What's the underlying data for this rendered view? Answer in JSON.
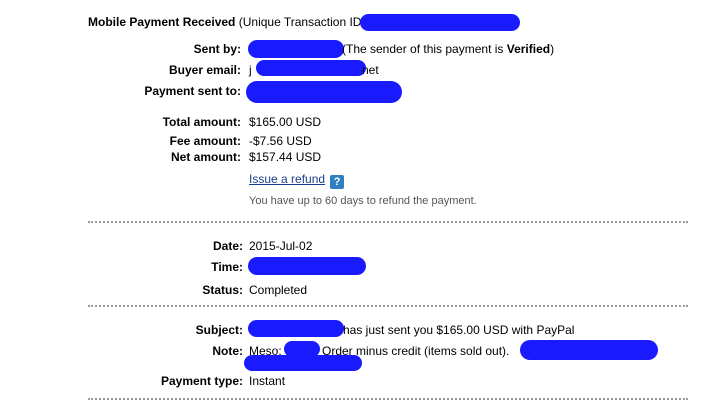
{
  "header": {
    "title": "Mobile Payment Received",
    "txn_prefix": "(Unique Transaction ID #"
  },
  "sent_by": {
    "label": "Sent by:",
    "note_prefix": "(The sender of this payment is ",
    "note_strong": "Verified",
    "note_suffix": ")"
  },
  "buyer_email": {
    "label": "Buyer email:",
    "start": "j",
    "end": "net"
  },
  "payment_sent_to": {
    "label": "Payment sent to:"
  },
  "amounts": {
    "total_label": "Total amount:",
    "total_value": "$165.00 USD",
    "fee_label": "Fee amount:",
    "fee_value": "-$7.56 USD",
    "net_label": "Net amount:",
    "net_value": "$157.44 USD"
  },
  "refund": {
    "link_label": "Issue a refund",
    "help_glyph": "?",
    "note": "You have up to 60 days to refund the payment."
  },
  "details": {
    "date_label": "Date:",
    "date_value": "2015-Jul-02",
    "time_label": "Time:",
    "status_label": "Status:",
    "status_value": "Completed"
  },
  "message": {
    "subject_label": "Subject:",
    "subject_value": "has just sent you $165.00 USD with PayPal",
    "note_label": "Note:",
    "note_prefix": "Meso:",
    "note_body": "Order minus credit (items sold out).",
    "payment_type_label": "Payment type:",
    "payment_type_value": "Instant"
  },
  "colors": {
    "redaction": "#1a1aff",
    "link": "#1a3e8e",
    "help_icon": "#2f7fc1"
  }
}
